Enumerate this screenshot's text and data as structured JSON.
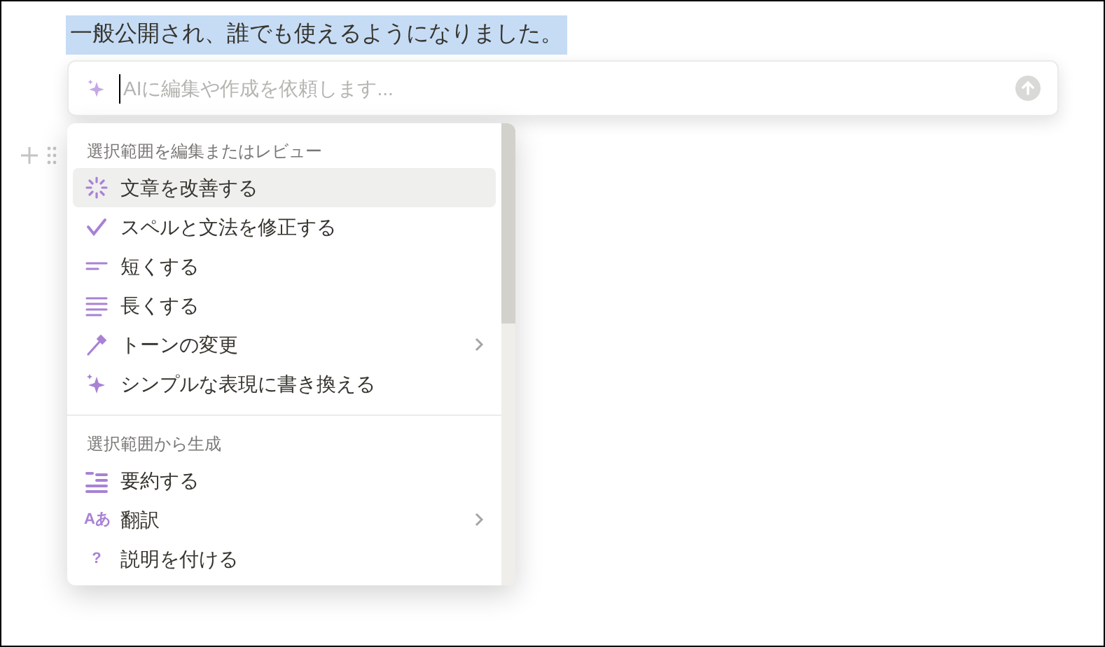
{
  "selected_text": "一般公開され、誰でも使えるようになりました。",
  "ai_input": {
    "placeholder": "AIに編集や作成を依頼します..."
  },
  "menu": {
    "sections": [
      {
        "heading": "選択範囲を編集またはレビュー",
        "items": [
          {
            "kind": "improve",
            "label": "文章を改善する",
            "selected": true,
            "submenu": false
          },
          {
            "kind": "check",
            "label": "スペルと文法を修正する",
            "selected": false,
            "submenu": false
          },
          {
            "kind": "shorter",
            "label": "短くする",
            "selected": false,
            "submenu": false
          },
          {
            "kind": "longer",
            "label": "長くする",
            "selected": false,
            "submenu": false
          },
          {
            "kind": "tone",
            "label": "トーンの変更",
            "selected": false,
            "submenu": true
          },
          {
            "kind": "simplify",
            "label": "シンプルな表現に書き換える",
            "selected": false,
            "submenu": false
          }
        ]
      },
      {
        "heading": "選択範囲から生成",
        "items": [
          {
            "kind": "summary",
            "label": "要約する",
            "selected": false,
            "submenu": false
          },
          {
            "kind": "glyph",
            "icon_text": "Aあ",
            "label": "翻訳",
            "selected": false,
            "submenu": true
          },
          {
            "kind": "glyph",
            "icon_text": "?",
            "label": "説明を付ける",
            "selected": false,
            "submenu": false
          }
        ]
      }
    ]
  }
}
